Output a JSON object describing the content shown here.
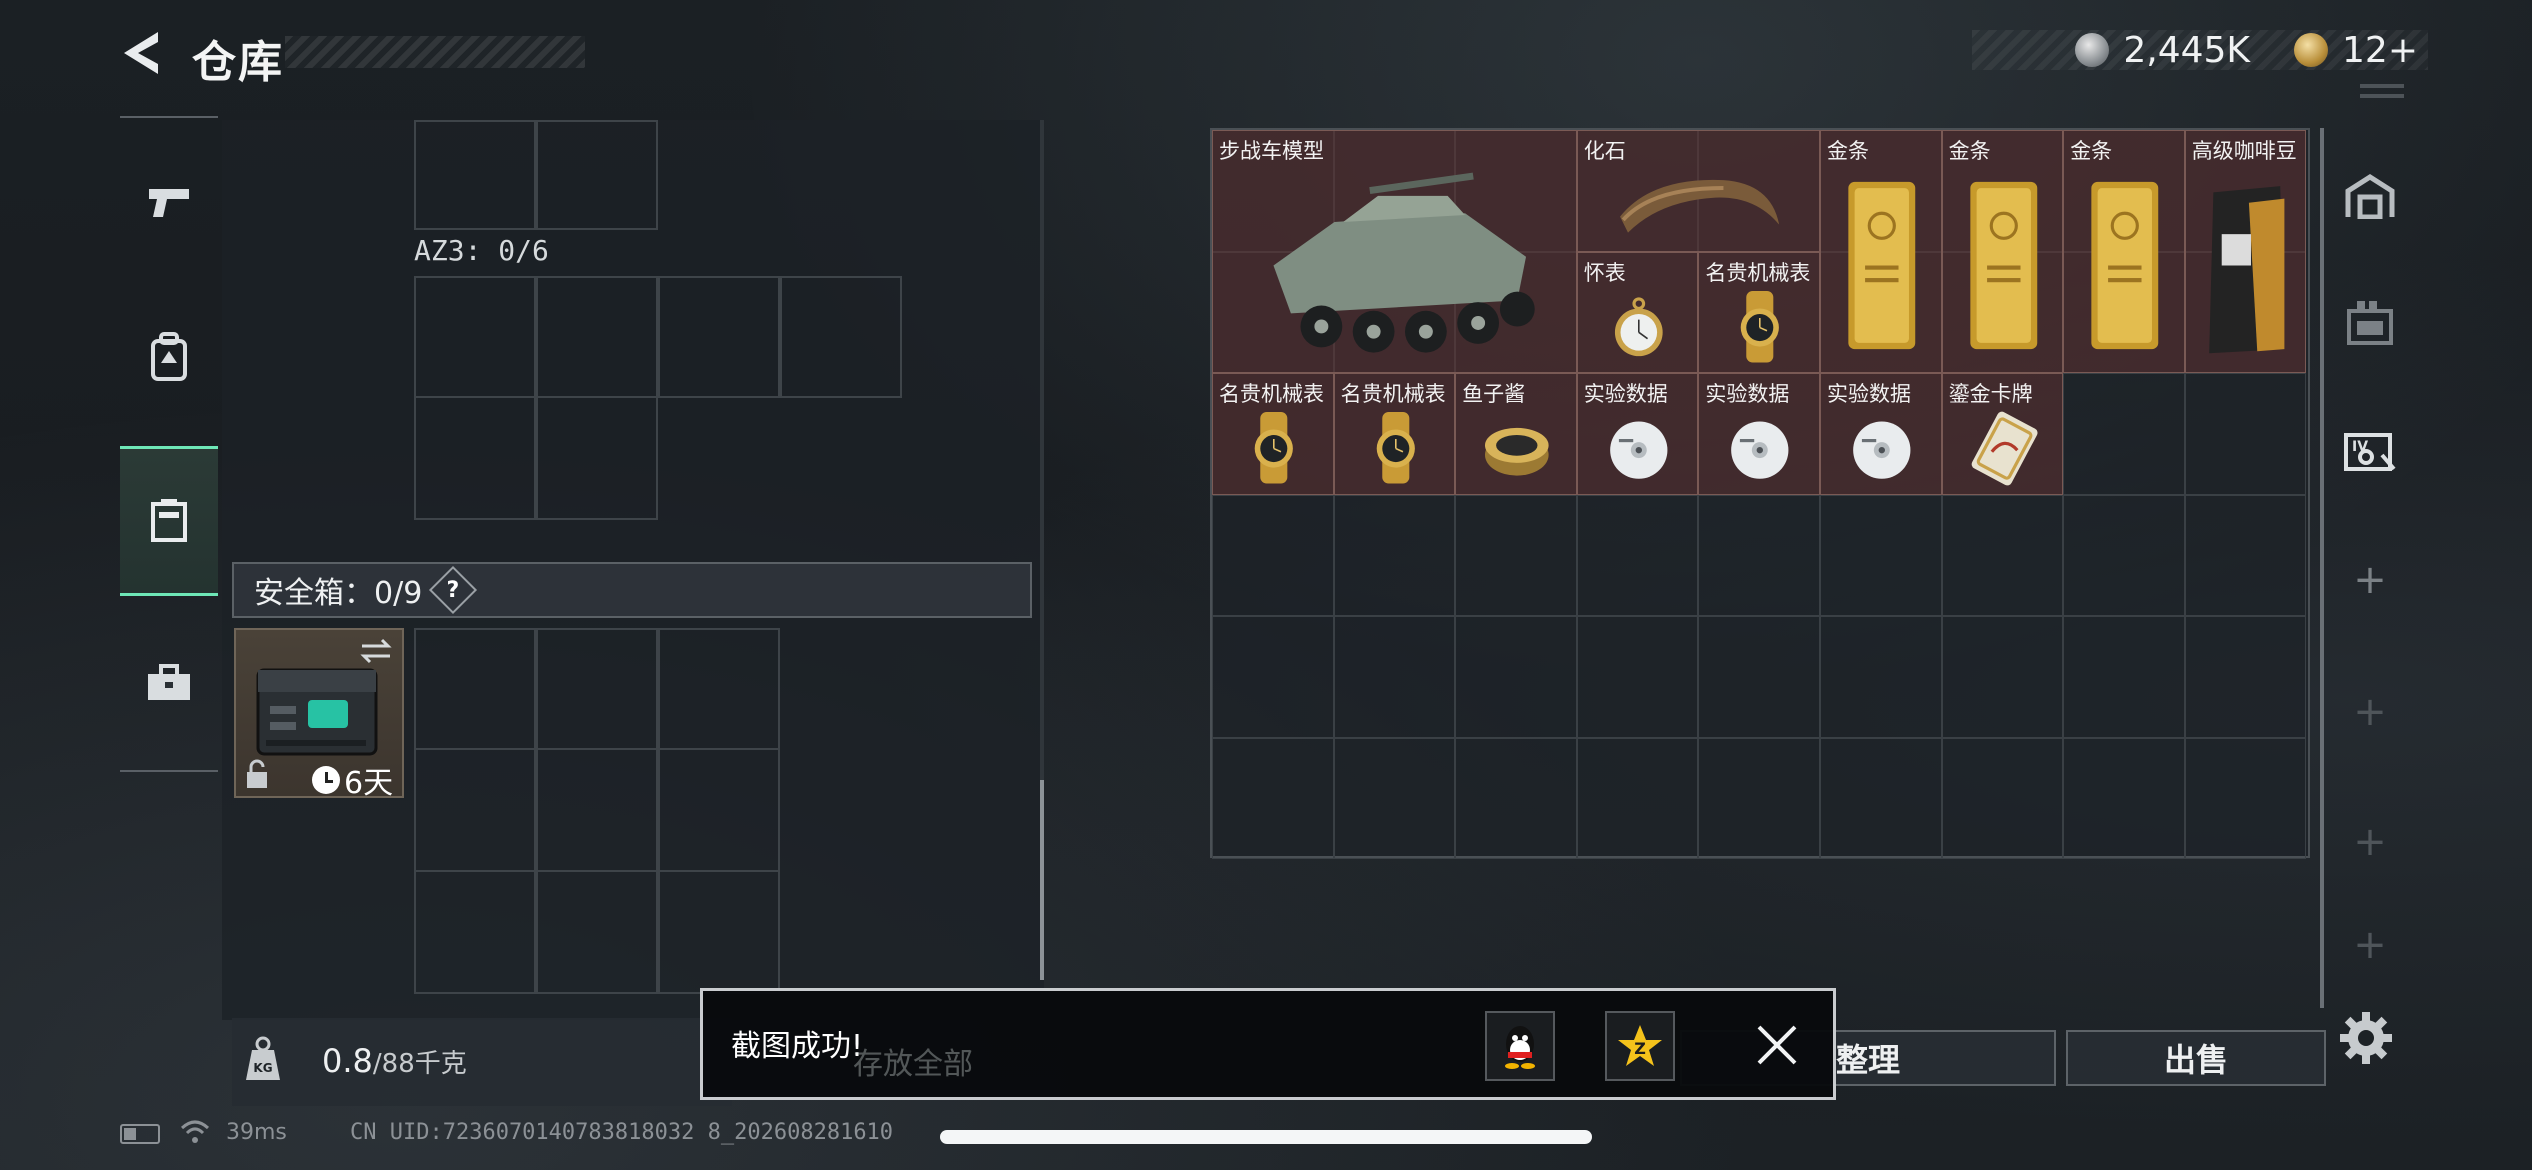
{
  "header": {
    "title": "仓库",
    "back_icon": "back-arrow-icon",
    "currency": [
      {
        "icon": "silver-coin-icon",
        "value": "2,445K"
      },
      {
        "icon": "gold-coin-icon",
        "value": "12+"
      }
    ]
  },
  "left_nav": {
    "items": [
      {
        "icon": "pistol-icon",
        "active": false
      },
      {
        "icon": "backpack-icon",
        "active": false
      },
      {
        "icon": "chest-rig-icon",
        "active": true
      },
      {
        "icon": "toolbox-icon",
        "active": false
      }
    ]
  },
  "left_panel": {
    "az3_label": "AZ3: 0/6",
    "safe_box_label": "安全箱：0/9",
    "help": "?",
    "safe_item": {
      "days": "6天",
      "icon": "safe-box-icon"
    },
    "weight": {
      "current": "0.8",
      "max": "/88千克",
      "icon": "weight-kg-icon"
    }
  },
  "grid_items": [
    {
      "name": "步战车模型",
      "art": "ifv-model"
    },
    {
      "name": "化石",
      "art": "fossil"
    },
    {
      "name": "怀表",
      "art": "pocket-watch"
    },
    {
      "name": "名贵机械表",
      "art": "watch"
    },
    {
      "name": "金条",
      "art": "gold-bar"
    },
    {
      "name": "金条",
      "art": "gold-bar"
    },
    {
      "name": "金条",
      "art": "gold-bar"
    },
    {
      "name": "高级咖啡豆",
      "art": "coffee-bag"
    },
    {
      "name": "名贵机械表",
      "art": "watch"
    },
    {
      "name": "名贵机械表",
      "art": "watch"
    },
    {
      "name": "鱼子酱",
      "art": "caviar"
    },
    {
      "name": "实验数据",
      "art": "disc"
    },
    {
      "name": "实验数据",
      "art": "disc"
    },
    {
      "name": "实验数据",
      "art": "disc"
    },
    {
      "name": "鎏金卡牌",
      "art": "gilded-card"
    }
  ],
  "right_nav": {
    "items": [
      "garage-icon",
      "storage-box-icon",
      "ticket-icon",
      "add-icon",
      "add-icon",
      "add-icon",
      "add-icon"
    ]
  },
  "actions": {
    "sort_label": "整理",
    "sell_label": "出售",
    "settings_icon": "gear-icon"
  },
  "toast": {
    "message": "截图成功!",
    "hidden_under_text": "存放全部",
    "buttons": [
      "qq-icon",
      "qzone-star-icon"
    ],
    "close_icon": "close-icon"
  },
  "status": {
    "ping": "39ms",
    "uid": "CN UID:7236070140783818032 8_202608281610"
  }
}
